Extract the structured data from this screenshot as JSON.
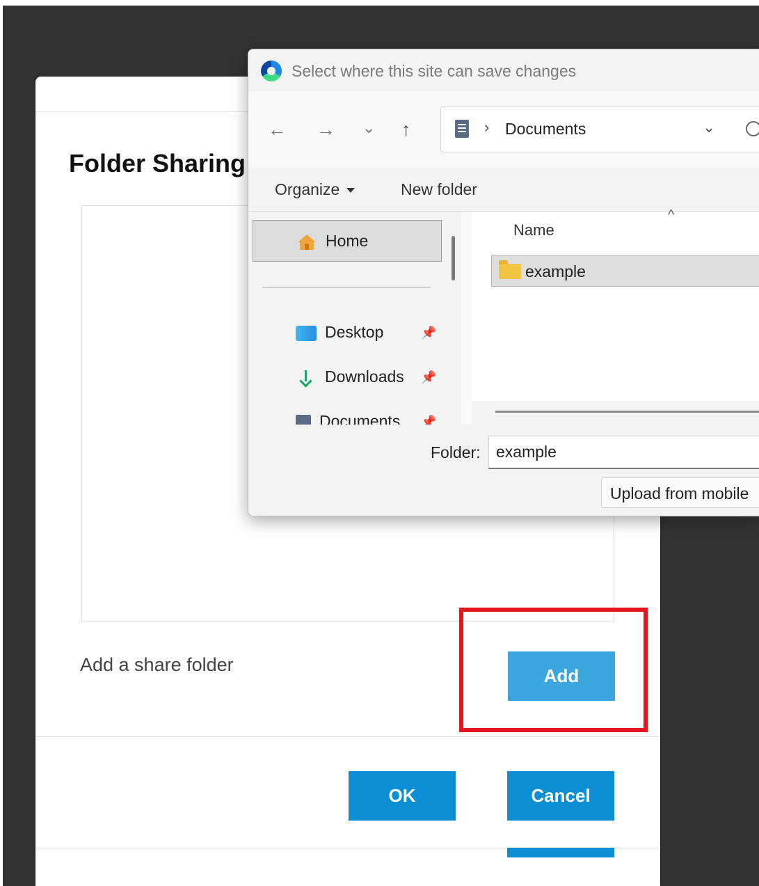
{
  "folder_sharing": {
    "title": "Folder Sharing",
    "add_label": "Add a share folder",
    "add_button": "Add",
    "ok_button": "OK",
    "cancel_button": "Cancel"
  },
  "picker": {
    "title": "Select where this site can save changes",
    "nav": {
      "back_icon": "←",
      "forward_icon": "→",
      "recent_icon": "⌄",
      "up_icon": "↑"
    },
    "address": {
      "separator": "›",
      "location": "Documents",
      "dropdown_icon": "⌄"
    },
    "commands": {
      "organize": "Organize",
      "new_folder": "New folder"
    },
    "sidebar": {
      "home": "Home",
      "items": [
        {
          "label": "Desktop",
          "icon": "desktop-icon"
        },
        {
          "label": "Downloads",
          "icon": "download-icon"
        },
        {
          "label": "Documents",
          "icon": "documents-icon"
        }
      ],
      "pin_icon": "📌"
    },
    "files": {
      "column_name": "Name",
      "sort_icon": "^",
      "rows": [
        {
          "name": "example",
          "icon": "folder-icon"
        }
      ]
    },
    "footer": {
      "folder_label": "Folder:",
      "folder_value": "example",
      "upload_button": "Upload from mobile"
    }
  },
  "colors": {
    "accent_blue": "#0b8ed3",
    "add_blue": "#3ca7df",
    "highlight_red": "#e3151f",
    "backdrop": "#333333"
  }
}
